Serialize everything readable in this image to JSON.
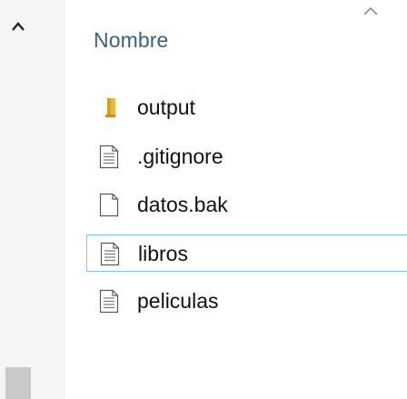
{
  "header": {
    "column_name": "Nombre",
    "sort_icon": "sort-up-icon"
  },
  "scrollbar": {
    "up_icon": "chevron-up-icon"
  },
  "files": [
    {
      "name": "output",
      "type": "folder",
      "icon": "folder-icon"
    },
    {
      "name": ".gitignore",
      "type": "text",
      "icon": "text-file-icon"
    },
    {
      "name": "datos.bak",
      "type": "blank",
      "icon": "file-icon"
    },
    {
      "name": "libros",
      "type": "text",
      "icon": "text-file-icon",
      "selected": true
    },
    {
      "name": "peliculas",
      "type": "text",
      "icon": "text-file-icon"
    }
  ],
  "colors": {
    "header_text": "#3c5f83",
    "selection_border": "#8fc3ef",
    "folder": "#e9b840"
  }
}
